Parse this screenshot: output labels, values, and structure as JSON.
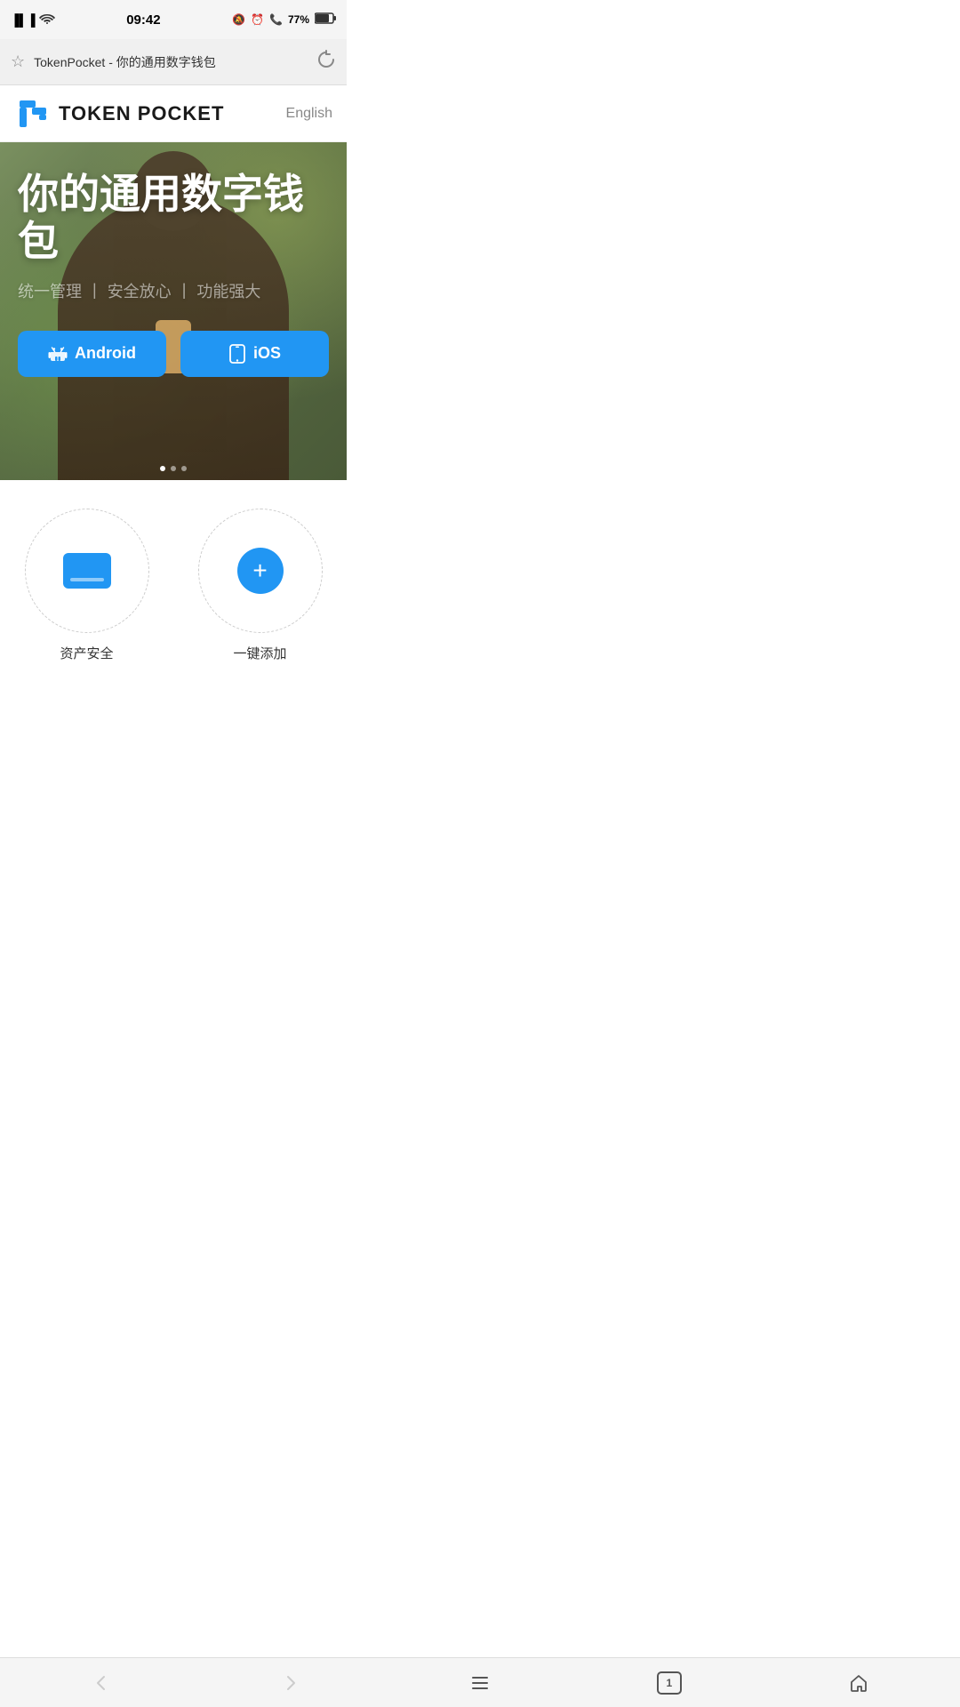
{
  "statusBar": {
    "time": "09:42",
    "signal": "4G 2G",
    "battery": "77%"
  },
  "addressBar": {
    "star": "☆",
    "url": "TokenPocket - 你的通用数字钱包",
    "reload": "↻"
  },
  "navbar": {
    "logoText": "TOKEN POCKET",
    "langSwitch": "English"
  },
  "hero": {
    "title": "你的通用数字钱包",
    "subtitleParts": [
      "统一管理",
      "安全放心",
      "功能强大"
    ],
    "androidBtn": "Android",
    "iosBtn": "iOS"
  },
  "features": [
    {
      "iconType": "card",
      "label": "资产安全"
    },
    {
      "iconType": "plus",
      "label": "一键添加"
    }
  ],
  "browserBar": {
    "back": "‹",
    "forward": "›",
    "menu": "≡",
    "tabCount": "1",
    "home": "⌂"
  }
}
